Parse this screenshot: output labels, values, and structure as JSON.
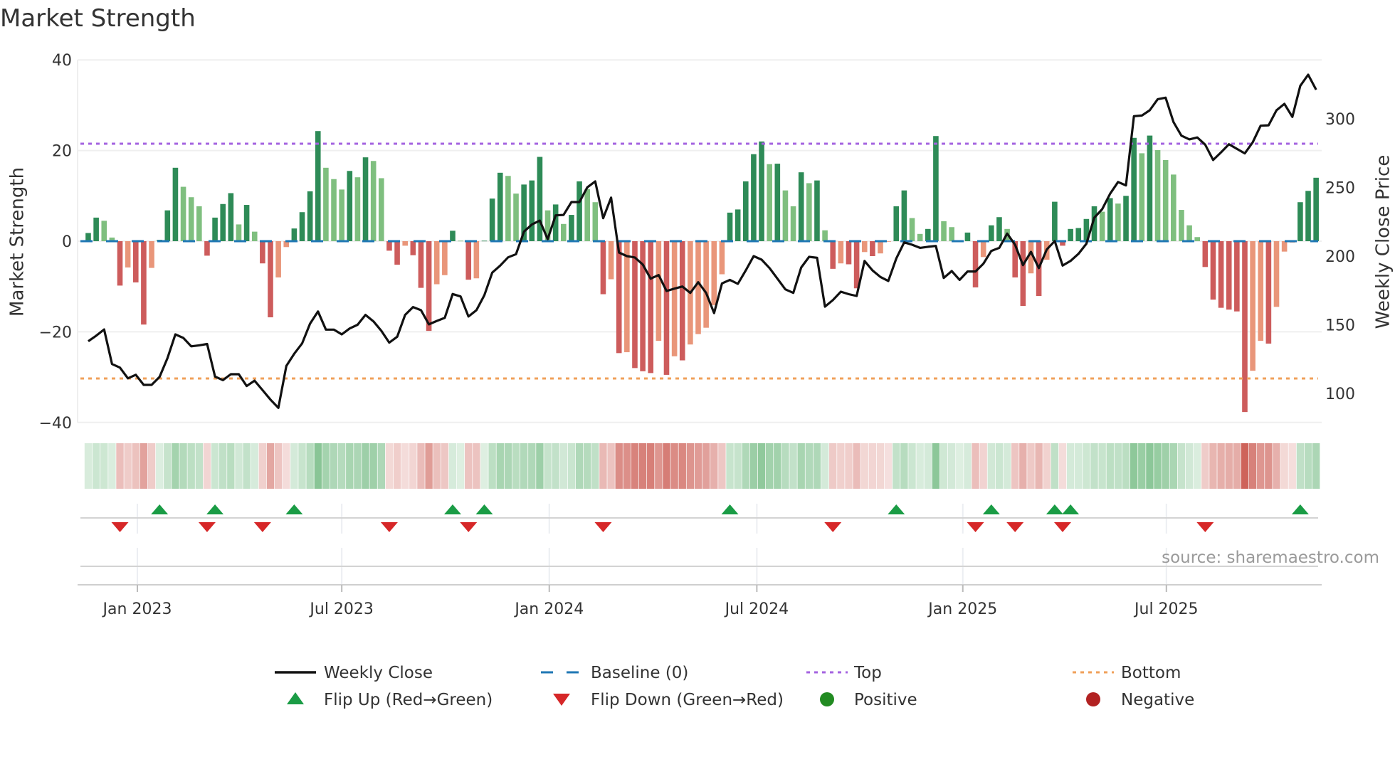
{
  "title": "Market Strength",
  "source": "source: sharemaestro.com",
  "colors": {
    "pos_strong": "#2e8b57",
    "pos_weak": "#7fbf7f",
    "neg_strong": "#cd5c5c",
    "neg_weak": "#e9967a",
    "baseline": "#1f77b4",
    "top": "#a463e0",
    "bottom": "#f0a05a",
    "line": "#111111",
    "flip_up": "#1a9c45",
    "flip_down": "#d62728",
    "positive": "#228b22",
    "negative": "#b22222"
  },
  "chart_data": {
    "type": "bar",
    "title": "Market Strength",
    "ylabel": "Market Strength",
    "y2label": "Weekly Close Price",
    "ylim": [
      -40,
      40
    ],
    "y2lim": [
      79.4,
      343.6
    ],
    "yticks": [
      "40",
      "20",
      "0",
      "−20",
      "−40"
    ],
    "ytick_values": [
      40,
      20,
      0,
      -20,
      -40
    ],
    "y2ticks": [
      "300",
      "250",
      "200",
      "150",
      "100"
    ],
    "y2tick_values": [
      300,
      250,
      200,
      150,
      100
    ],
    "top_level": 21.5,
    "bottom_level": -30.3,
    "baseline": 0,
    "xticks": [
      {
        "label": "Jan 2023",
        "week": 6.2
      },
      {
        "label": "Jul 2023",
        "week": 32.0
      },
      {
        "label": "Jan 2024",
        "week": 58.2
      },
      {
        "label": "Jul 2024",
        "week": 84.4
      },
      {
        "label": "Jan 2025",
        "week": 110.4
      },
      {
        "label": "Jul 2025",
        "week": 136.1
      }
    ],
    "strength": [
      1.8,
      5.2,
      4.5,
      0.8,
      -9.8,
      -5.8,
      -9.1,
      -18.4,
      -5.9,
      0.3,
      6.8,
      16.2,
      12.0,
      9.7,
      7.7,
      -3.2,
      5.2,
      8.2,
      10.6,
      3.7,
      8.0,
      2.1,
      -4.9,
      -16.8,
      -8.0,
      -1.3,
      2.8,
      6.4,
      11.0,
      24.3,
      16.2,
      13.7,
      11.4,
      15.5,
      14.1,
      18.5,
      17.7,
      13.9,
      -2.1,
      -5.2,
      -1.0,
      -3.1,
      -10.3,
      -19.8,
      -9.5,
      -7.5,
      2.3,
      0.1,
      -8.5,
      -8.2,
      0.1,
      9.4,
      15.1,
      14.4,
      10.5,
      12.5,
      13.4,
      18.6,
      6.8,
      8.1,
      3.8,
      5.8,
      13.2,
      11.5,
      8.6,
      -11.7,
      -8.4,
      -24.7,
      -24.5,
      -28.0,
      -28.7,
      -29.1,
      -22.0,
      -29.5,
      -25.4,
      -26.3,
      -22.8,
      -20.5,
      -19.1,
      -14.1,
      -7.3,
      6.3,
      7.0,
      13.2,
      19.2,
      22.0,
      17.0,
      17.1,
      11.2,
      7.7,
      15.2,
      12.8,
      13.4,
      2.4,
      -6.1,
      -4.9,
      -5.1,
      -10.4,
      -2.4,
      -3.3,
      -2.7,
      -0.1,
      7.7,
      11.2,
      5.1,
      1.6,
      2.7,
      23.2,
      4.4,
      3.1,
      0.2,
      1.9,
      -10.2,
      -3.5,
      3.5,
      5.3,
      2.7,
      -8.0,
      -14.3,
      -7.1,
      -12.1,
      -4.1,
      8.7,
      -1.0,
      2.7,
      2.9,
      4.9,
      7.7,
      6.5,
      9.5,
      8.3,
      10.0,
      22.8,
      19.4,
      23.3,
      20.1,
      17.9,
      14.7,
      6.9,
      3.5,
      0.9,
      -5.7,
      -12.9,
      -14.7,
      -15.1,
      -15.5,
      -37.7,
      -28.6,
      -22.0,
      -22.6,
      -14.5,
      -2.3,
      -0.3,
      8.6,
      11.1,
      14.0
    ],
    "weekly_close": [
      138,
      142,
      146.6,
      121.4,
      118.8,
      111,
      113.6,
      106.2,
      106.2,
      112,
      125.7,
      143,
      140.4,
      134.3,
      135,
      136,
      112.3,
      109.7,
      114,
      114,
      105.4,
      109.3,
      102.4,
      95.5,
      89.5,
      120,
      128.9,
      136.4,
      150.8,
      159.7,
      146.5,
      146.5,
      143,
      147.3,
      150,
      157.2,
      152.5,
      145.6,
      137,
      141.3,
      157.2,
      162.9,
      160.6,
      150.3,
      152.8,
      155,
      172.4,
      170.6,
      156,
      160.6,
      171.5,
      188,
      193.1,
      199.1,
      201.4,
      217.8,
      223,
      225.9,
      212.4,
      229.7,
      230,
      239.4,
      239.4,
      250.1,
      254.4,
      227.6,
      242.6,
      202.6,
      200,
      199,
      193.9,
      183.6,
      186.2,
      174.6,
      176.3,
      177.9,
      173.2,
      181,
      173.2,
      158.5,
      180.1,
      182.7,
      179.8,
      189.6,
      200,
      197.4,
      191.3,
      183.6,
      175.8,
      173.2,
      191.7,
      199.5,
      198.8,
      163.2,
      168,
      174.1,
      172.3,
      171,
      196.5,
      189.6,
      184.8,
      181.9,
      198.3,
      210,
      208.3,
      206,
      206.8,
      207.4,
      184.1,
      189.1,
      182.7,
      188.8,
      188.8,
      194.5,
      203.8,
      206,
      216.4,
      208.3,
      193.4,
      203.1,
      191.3,
      204.8,
      211,
      193.1,
      196.5,
      201.7,
      209,
      228,
      234.2,
      245.5,
      254,
      251.5,
      301.9,
      302.4,
      306.2,
      314.3,
      315.4,
      297.6,
      287.7,
      285,
      286.4,
      281.2,
      270,
      275.6,
      281.5,
      278.1,
      274.8,
      282.9,
      295,
      295.3,
      306.2,
      310.9,
      301.4,
      324,
      332.1,
      321.2
    ],
    "flip_up_weeks": [
      10,
      17,
      27,
      47,
      51,
      82,
      103,
      115,
      123,
      125,
      154
    ],
    "flip_down_weeks": [
      5,
      16,
      23,
      39,
      49,
      66,
      95,
      113,
      118,
      124,
      142
    ],
    "legend": [
      {
        "label": "Weekly Close",
        "symbol": "line"
      },
      {
        "label": "Baseline (0)",
        "symbol": "dash"
      },
      {
        "label": "Top",
        "symbol": "dot-purple"
      },
      {
        "label": "Bottom",
        "symbol": "dot-orange"
      },
      {
        "label": "Flip Up (Red→Green)",
        "symbol": "triangle-up"
      },
      {
        "label": "Flip Down (Green→Red)",
        "symbol": "triangle-down"
      },
      {
        "label": "Positive",
        "symbol": "circle-green"
      },
      {
        "label": "Negative",
        "symbol": "circle-red"
      }
    ],
    "legend_position": "bottom"
  }
}
